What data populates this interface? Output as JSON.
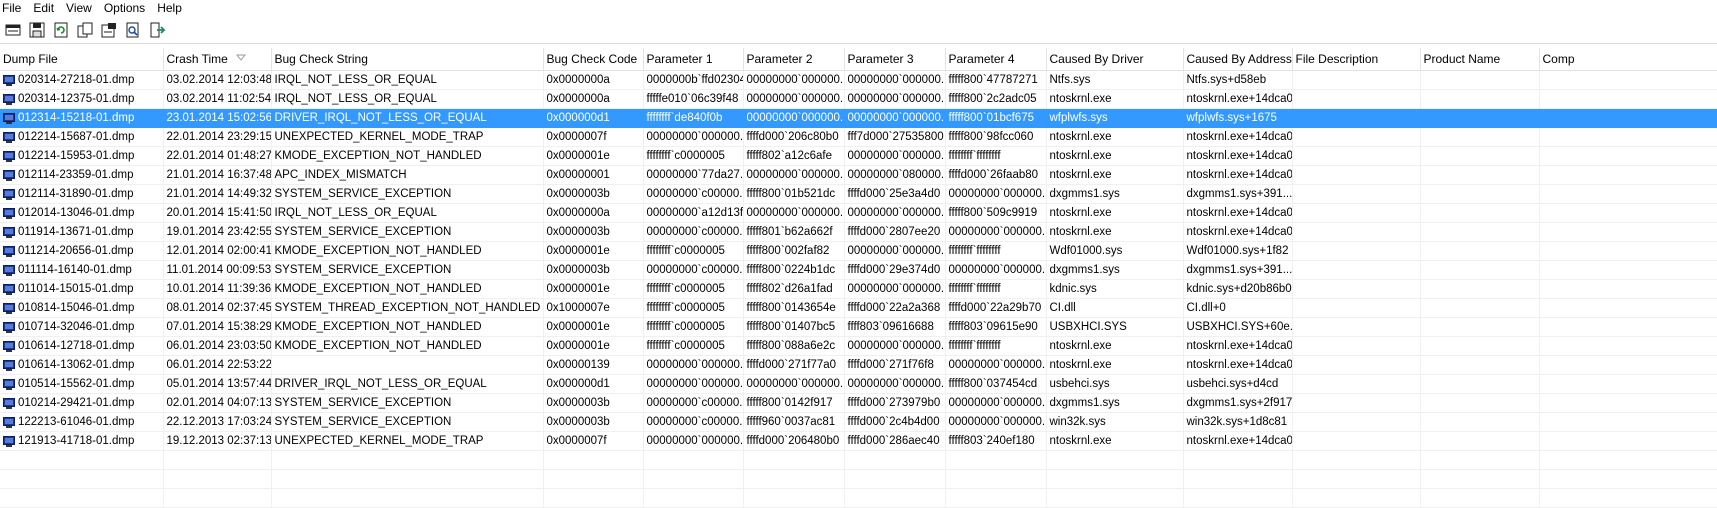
{
  "menu": [
    "File",
    "Edit",
    "View",
    "Options",
    "Help"
  ],
  "toolbar": [
    {
      "name": "html-report-icon"
    },
    {
      "name": "save-icon"
    },
    {
      "name": "refresh-icon"
    },
    {
      "name": "copy-icon"
    },
    {
      "name": "properties-icon"
    },
    {
      "name": "find-icon"
    },
    {
      "name": "exit-icon"
    }
  ],
  "columns": [
    "Dump File",
    "Crash Time",
    "Bug Check String",
    "Bug Check Code",
    "Parameter 1",
    "Parameter 2",
    "Parameter 3",
    "Parameter 4",
    "Caused By Driver",
    "Caused By Address",
    "File Description",
    "Product Name",
    "Comp"
  ],
  "sorted_column": "Crash Time",
  "selected_row": 2,
  "colors": {
    "selection": "#3399ff",
    "dump_icon": "#1a3a9a"
  },
  "rows": [
    [
      "020314-27218-01.dmp",
      "03.02.2014 12:03:48",
      "IRQL_NOT_LESS_OR_EQUAL",
      "0x0000000a",
      "0000000b`ffd02304",
      "00000000`000000...",
      "00000000`000000...",
      "fffff800`47787271",
      "Ntfs.sys",
      "Ntfs.sys+d58eb",
      "",
      "",
      ""
    ],
    [
      "020314-12375-01.dmp",
      "03.02.2014 11:02:54",
      "IRQL_NOT_LESS_OR_EQUAL",
      "0x0000000a",
      "fffffe010`06c39f48",
      "00000000`000000...",
      "00000000`000000...",
      "fffff800`2c2adc05",
      "ntoskrnl.exe",
      "ntoskrnl.exe+14dca0",
      "",
      "",
      ""
    ],
    [
      "012314-15218-01.dmp",
      "23.01.2014 15:02:56",
      "DRIVER_IRQL_NOT_LESS_OR_EQUAL",
      "0x000000d1",
      "ffffffff`de840f0b",
      "00000000`000000...",
      "00000000`000000...",
      "fffff800`01bcf675",
      "wfplwfs.sys",
      "wfplwfs.sys+1675",
      "",
      "",
      ""
    ],
    [
      "012214-15687-01.dmp",
      "22.01.2014 23:29:15",
      "UNEXPECTED_KERNEL_MODE_TRAP",
      "0x0000007f",
      "00000000`000000...",
      "ffffd000`206c80b0",
      "fff7d000`27535800",
      "fffff800`98fcc060",
      "ntoskrnl.exe",
      "ntoskrnl.exe+14dca0",
      "",
      "",
      ""
    ],
    [
      "012214-15953-01.dmp",
      "22.01.2014 01:48:27",
      "KMODE_EXCEPTION_NOT_HANDLED",
      "0x0000001e",
      "ffffffff`c0000005",
      "fffff802`a12c6afe",
      "00000000`000000...",
      "ffffffff`ffffffff",
      "ntoskrnl.exe",
      "ntoskrnl.exe+14dca0",
      "",
      "",
      ""
    ],
    [
      "012114-23359-01.dmp",
      "21.01.2014 16:37:48",
      "APC_INDEX_MISMATCH",
      "0x00000001",
      "00000000`77da27...",
      "00000000`000000...",
      "00000000`080000...",
      "ffffd000`26faab80",
      "ntoskrnl.exe",
      "ntoskrnl.exe+14dca0",
      "",
      "",
      ""
    ],
    [
      "012114-31890-01.dmp",
      "21.01.2014 14:49:32",
      "SYSTEM_SERVICE_EXCEPTION",
      "0x0000003b",
      "00000000`c00000...",
      "fffff800`01b521dc",
      "ffffd000`25e3a4d0",
      "00000000`000000...",
      "dxgmms1.sys",
      "dxgmms1.sys+391...",
      "",
      "",
      ""
    ],
    [
      "012014-13046-01.dmp",
      "20.01.2014 15:41:50",
      "IRQL_NOT_LESS_OR_EQUAL",
      "0x0000000a",
      "00000000`a12d13f3",
      "00000000`000000...",
      "00000000`000000...",
      "fffff800`509c9919",
      "ntoskrnl.exe",
      "ntoskrnl.exe+14dca0",
      "",
      "",
      ""
    ],
    [
      "011914-13671-01.dmp",
      "19.01.2014 23:42:55",
      "SYSTEM_SERVICE_EXCEPTION",
      "0x0000003b",
      "00000000`c00000...",
      "fffff801`b62a662f",
      "ffffd000`2807ee20",
      "00000000`000000...",
      "ntoskrnl.exe",
      "ntoskrnl.exe+14dca0",
      "",
      "",
      ""
    ],
    [
      "011214-20656-01.dmp",
      "12.01.2014 02:00:41",
      "KMODE_EXCEPTION_NOT_HANDLED",
      "0x0000001e",
      "ffffffff`c0000005",
      "fffff800`002faf82",
      "00000000`000000...",
      "ffffffff`ffffffff",
      "Wdf01000.sys",
      "Wdf01000.sys+1f82",
      "",
      "",
      ""
    ],
    [
      "011114-16140-01.dmp",
      "11.01.2014 00:09:53",
      "SYSTEM_SERVICE_EXCEPTION",
      "0x0000003b",
      "00000000`c00000...",
      "fffff800`0224b1dc",
      "ffffd000`29e374d0",
      "00000000`000000...",
      "dxgmms1.sys",
      "dxgmms1.sys+391...",
      "",
      "",
      ""
    ],
    [
      "011014-15015-01.dmp",
      "10.01.2014 11:39:36",
      "KMODE_EXCEPTION_NOT_HANDLED",
      "0x0000001e",
      "ffffffff`c0000005",
      "fffff802`d26a1fad",
      "00000000`000000...",
      "ffffffff`ffffffff",
      "kdnic.sys",
      "kdnic.sys+d20b86b0",
      "",
      "",
      ""
    ],
    [
      "010814-15046-01.dmp",
      "08.01.2014 02:37:45",
      "SYSTEM_THREAD_EXCEPTION_NOT_HANDLED",
      "0x1000007e",
      "ffffffff`c0000005",
      "fffff800`0143654e",
      "ffffd000`22a2a368",
      "ffffd000`22a29b70",
      "CI.dll",
      "CI.dll+0",
      "",
      "",
      ""
    ],
    [
      "010714-32046-01.dmp",
      "07.01.2014 15:38:29",
      "KMODE_EXCEPTION_NOT_HANDLED",
      "0x0000001e",
      "ffffffff`c0000005",
      "fffff800`01407bc5",
      "ffff803`09616688",
      "fffff803`09615e90",
      "USBXHCI.SYS",
      "USBXHCI.SYS+60e...",
      "",
      "",
      ""
    ],
    [
      "010614-12718-01.dmp",
      "06.01.2014 23:03:50",
      "KMODE_EXCEPTION_NOT_HANDLED",
      "0x0000001e",
      "ffffffff`c0000005",
      "fffff800`088a6e2c",
      "00000000`000000...",
      "ffffffff`ffffffff",
      "ntoskrnl.exe",
      "ntoskrnl.exe+14dca0",
      "",
      "",
      ""
    ],
    [
      "010614-13062-01.dmp",
      "06.01.2014 22:53:22",
      "",
      "0x00000139",
      "00000000`000000...",
      "ffffd000`271f77a0",
      "ffffd000`271f76f8",
      "00000000`000000...",
      "ntoskrnl.exe",
      "ntoskrnl.exe+14dca0",
      "",
      "",
      ""
    ],
    [
      "010514-15562-01.dmp",
      "05.01.2014 13:57:44",
      "DRIVER_IRQL_NOT_LESS_OR_EQUAL",
      "0x000000d1",
      "00000000`000000...",
      "00000000`000000...",
      "00000000`000000...",
      "fffff800`037454cd",
      "usbehci.sys",
      "usbehci.sys+d4cd",
      "",
      "",
      ""
    ],
    [
      "010214-29421-01.dmp",
      "02.01.2014 04:07:13",
      "SYSTEM_SERVICE_EXCEPTION",
      "0x0000003b",
      "00000000`c00000...",
      "fffff800`0142f917",
      "ffffd000`273979b0",
      "00000000`000000...",
      "dxgmms1.sys",
      "dxgmms1.sys+2f917",
      "",
      "",
      ""
    ],
    [
      "122213-61046-01.dmp",
      "22.12.2013 17:03:24",
      "SYSTEM_SERVICE_EXCEPTION",
      "0x0000003b",
      "00000000`c00000...",
      "fffff960`0037ac81",
      "ffffd000`2c4b4d00",
      "00000000`000000...",
      "win32k.sys",
      "win32k.sys+1d8c81",
      "",
      "",
      ""
    ],
    [
      "121913-41718-01.dmp",
      "19.12.2013 02:37:13",
      "UNEXPECTED_KERNEL_MODE_TRAP",
      "0x0000007f",
      "00000000`000000...",
      "ffffd000`206480b0",
      "ffffd000`286aec40",
      "fffff803`240ef180",
      "ntoskrnl.exe",
      "ntoskrnl.exe+14dca0",
      "",
      "",
      ""
    ]
  ]
}
